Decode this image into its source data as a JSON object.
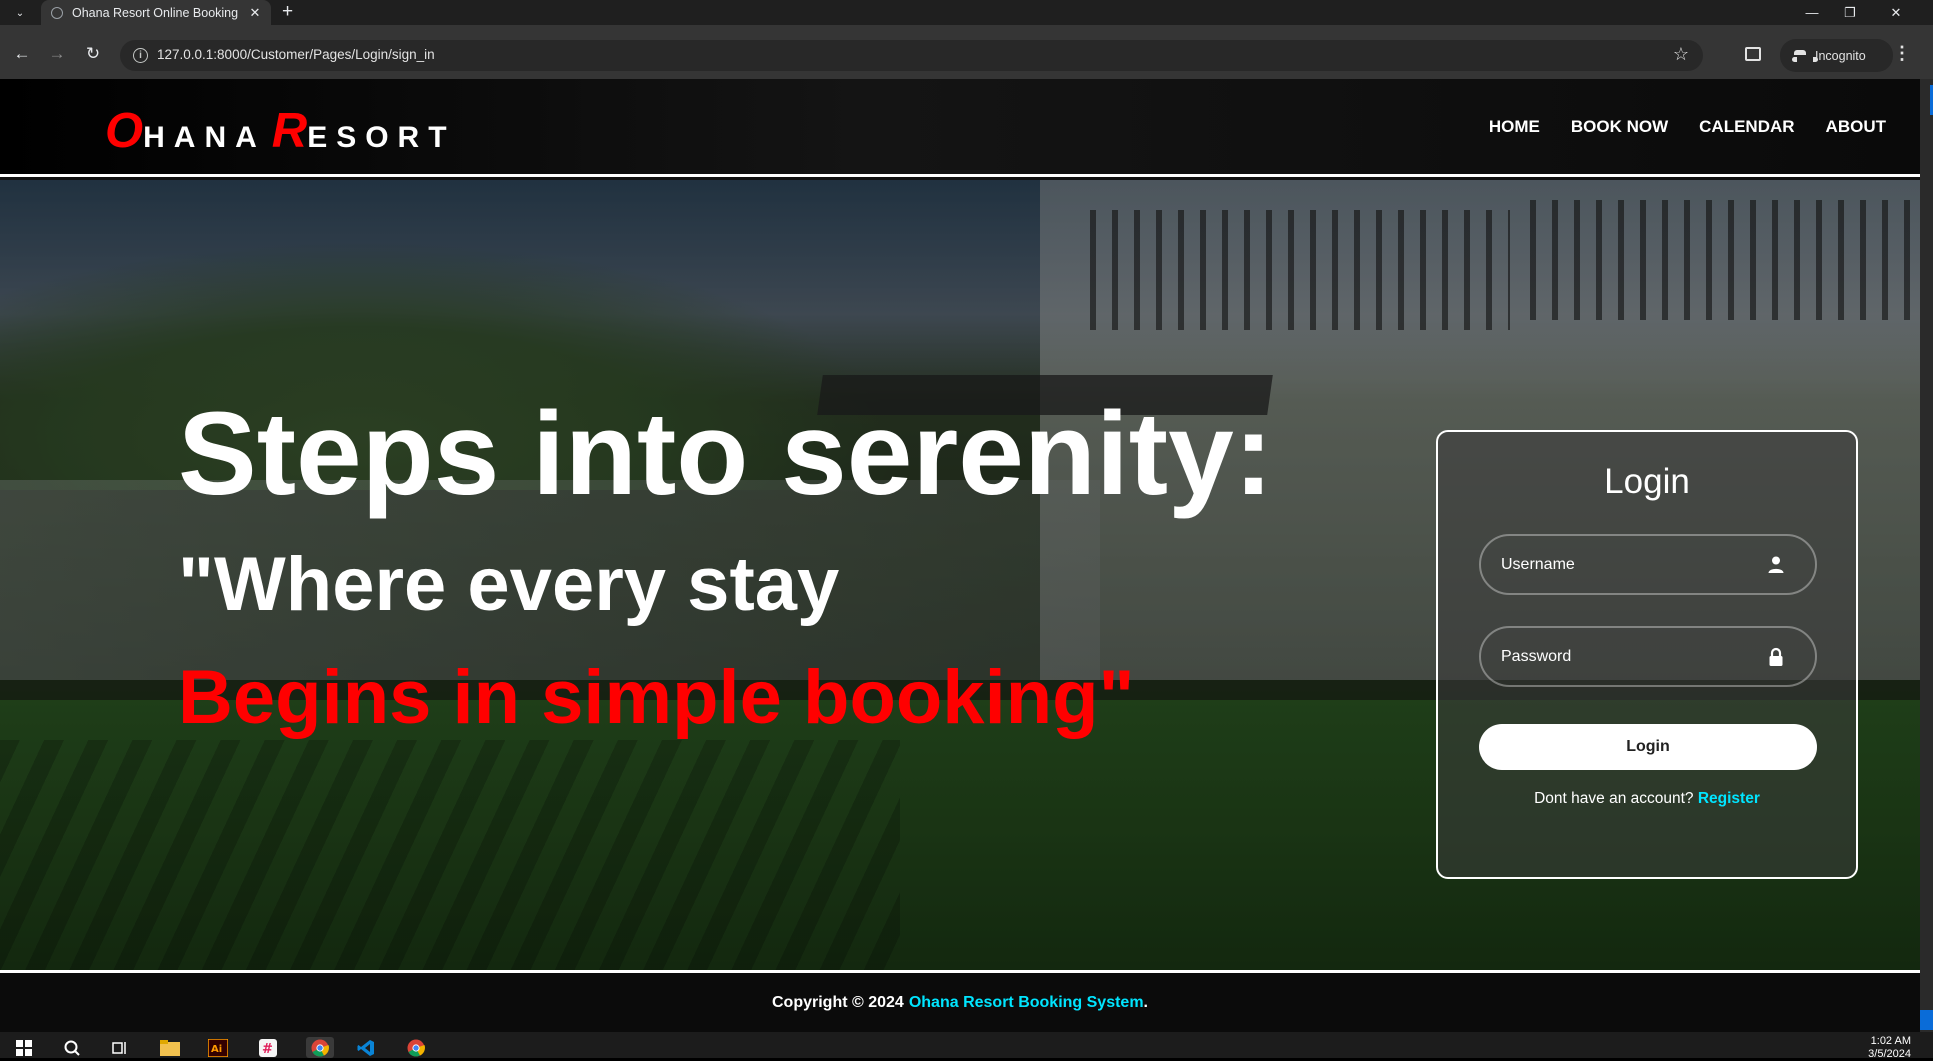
{
  "browser": {
    "tab_title": "Ohana Resort Online Booking",
    "url": "127.0.0.1:8000/Customer/Pages/Login/sign_in",
    "profile_label": "Incognito"
  },
  "site": {
    "logo": {
      "first_initial": "O",
      "first_rest": "HANA",
      "second_initial": "R",
      "second_rest": "ESORT"
    },
    "nav": [
      "HOME",
      "BOOK NOW",
      "CALENDAR",
      "ABOUT"
    ],
    "hero": {
      "headline": "Steps into serenity:",
      "subline": "\"Where every stay",
      "redline": "Begins in simple booking\""
    },
    "login": {
      "title": "Login",
      "username_placeholder": "Username",
      "password_placeholder": "Password",
      "button_label": "Login",
      "register_prompt": "Dont have an account?",
      "register_link": "Register"
    },
    "footer": {
      "copyright": "Copyright © 2024",
      "brand": "Ohana Resort Booking System",
      "suffix": "."
    }
  },
  "taskbar": {
    "time": "1:02 AM",
    "date": "3/5/2024"
  },
  "colors": {
    "logo_accent": "#ff0000",
    "link_accent": "#00e5ff",
    "hero_red": "#ff0000"
  }
}
